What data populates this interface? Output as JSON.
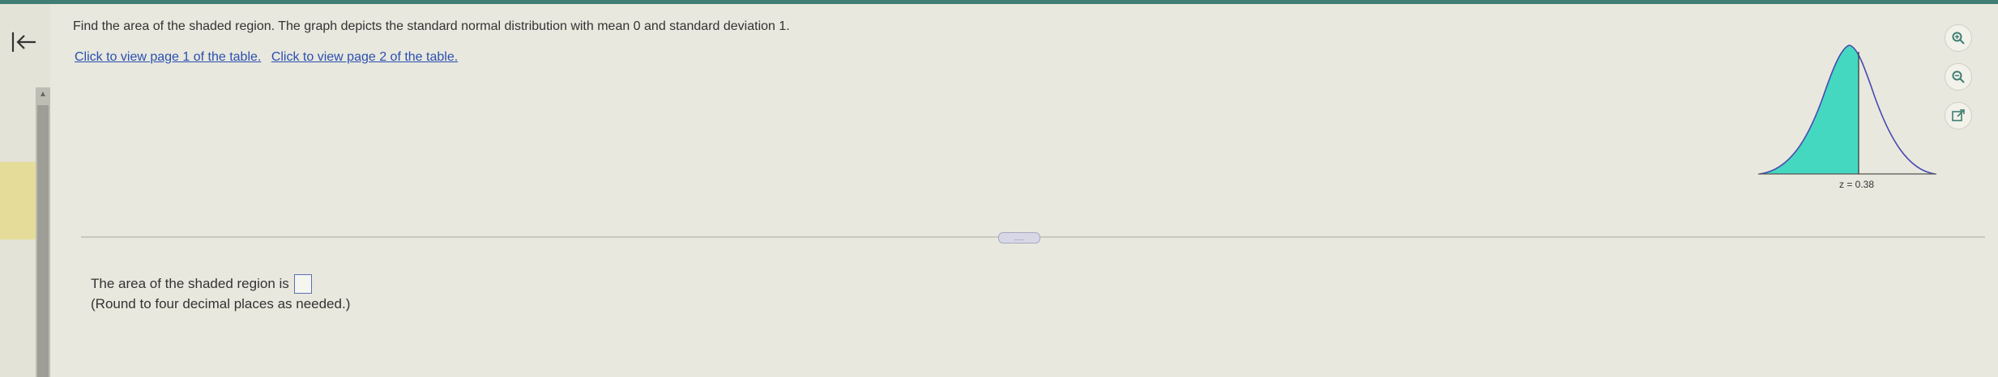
{
  "question": {
    "text": "Find the area of the shaded region. The graph depicts the standard normal distribution with mean 0 and standard deviation 1.",
    "link1": "Click to view page 1 of the table.",
    "link2": "Click to view page 2 of the table."
  },
  "graph": {
    "z_label": "z = 0.38",
    "shade_color": "#45d8c0",
    "curve_color": "#4a4ab0"
  },
  "answer": {
    "prompt": "The area of the shaded region is",
    "note": "(Round to four decimal places as needed.)"
  },
  "divider": {
    "handle_label": "....."
  },
  "tools": [
    {
      "icon": "zoom-in-icon"
    },
    {
      "icon": "zoom-out-icon"
    },
    {
      "icon": "external-link-icon"
    }
  ],
  "colors": {
    "accent": "#3f7e72",
    "link": "#2a4fb0"
  }
}
